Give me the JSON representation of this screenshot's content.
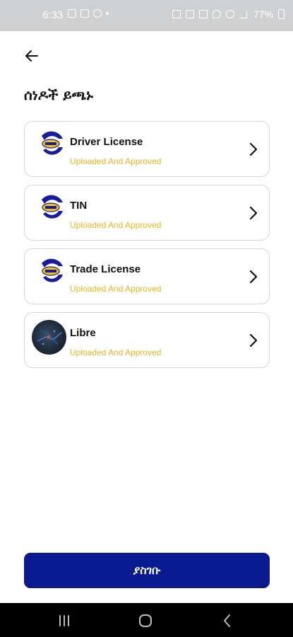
{
  "status_bar": {
    "time": "6:33",
    "battery": "77%"
  },
  "header": {
    "title": "ሰነዶች ይጫኑ"
  },
  "documents": [
    {
      "name": "Driver License",
      "status": "Uploaded And Approved",
      "icon": "logo-icon"
    },
    {
      "name": "TIN",
      "status": "Uploaded And Approved",
      "icon": "logo-icon"
    },
    {
      "name": "Trade License",
      "status": "Uploaded And Approved",
      "icon": "logo-icon"
    },
    {
      "name": "Libre",
      "status": "Uploaded And Approved",
      "icon": "photo-thumbnail"
    }
  ],
  "footer": {
    "submit_label": "ያስገቡ"
  },
  "colors": {
    "accent": "#0a1a8f",
    "status": "#e6b422",
    "card_border": "#d6d6d6"
  }
}
